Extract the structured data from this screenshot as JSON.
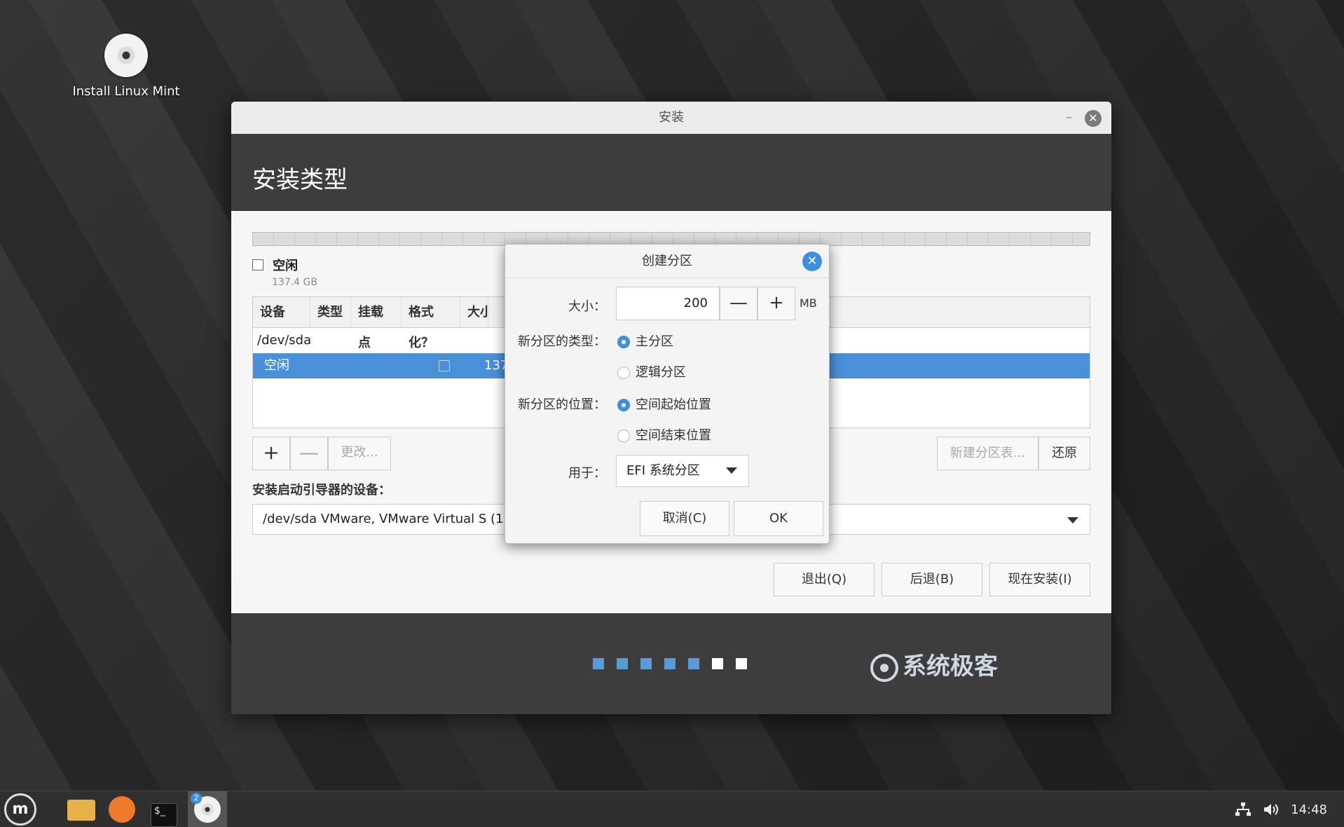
{
  "desktop": {
    "icon_label": "Install Linux Mint"
  },
  "window": {
    "title": "安装",
    "minimize": "–",
    "close": "✕",
    "header": "安装类型"
  },
  "partition": {
    "free_label": "空闲",
    "free_size": "137.4 GB",
    "columns": [
      "设备",
      "类型",
      "挂载点",
      "格式化？",
      "大小"
    ],
    "rows": [
      {
        "device": "/dev/sda"
      },
      {
        "device": "空闲",
        "size": "137"
      }
    ],
    "add": "+",
    "remove": "—",
    "change": "更改...",
    "new_table": "新建分区表...",
    "revert": "还原"
  },
  "boot": {
    "label": "安装启动引导器的设备：",
    "value": "/dev/sda VMware, VMware Virtual S (1"
  },
  "nav": {
    "quit": "退出(Q)",
    "back": "后退(B)",
    "install": "现在安装(I)"
  },
  "progress": {
    "total_steps": 7,
    "completed_steps": 5
  },
  "brand": "系统极客",
  "dialog": {
    "title": "创建分区",
    "close": "✕",
    "size_label": "大小：",
    "size_value": "200",
    "minus": "—",
    "plus": "+",
    "unit": "MB",
    "type_label": "新分区的类型：",
    "type_primary": "主分区",
    "type_logical": "逻辑分区",
    "pos_label": "新分区的位置：",
    "pos_begin": "空间起始位置",
    "pos_end": "空间结束位置",
    "use_label": "用于：",
    "use_value": "EFI 系统分区",
    "cancel": "取消(C)",
    "ok": "OK"
  },
  "taskbar": {
    "menu_glyph": "m",
    "terminal_glyph": "$_",
    "badge": "2",
    "network_icon": "network-icon",
    "volume_icon": "volume-icon",
    "clock": "14:48"
  }
}
